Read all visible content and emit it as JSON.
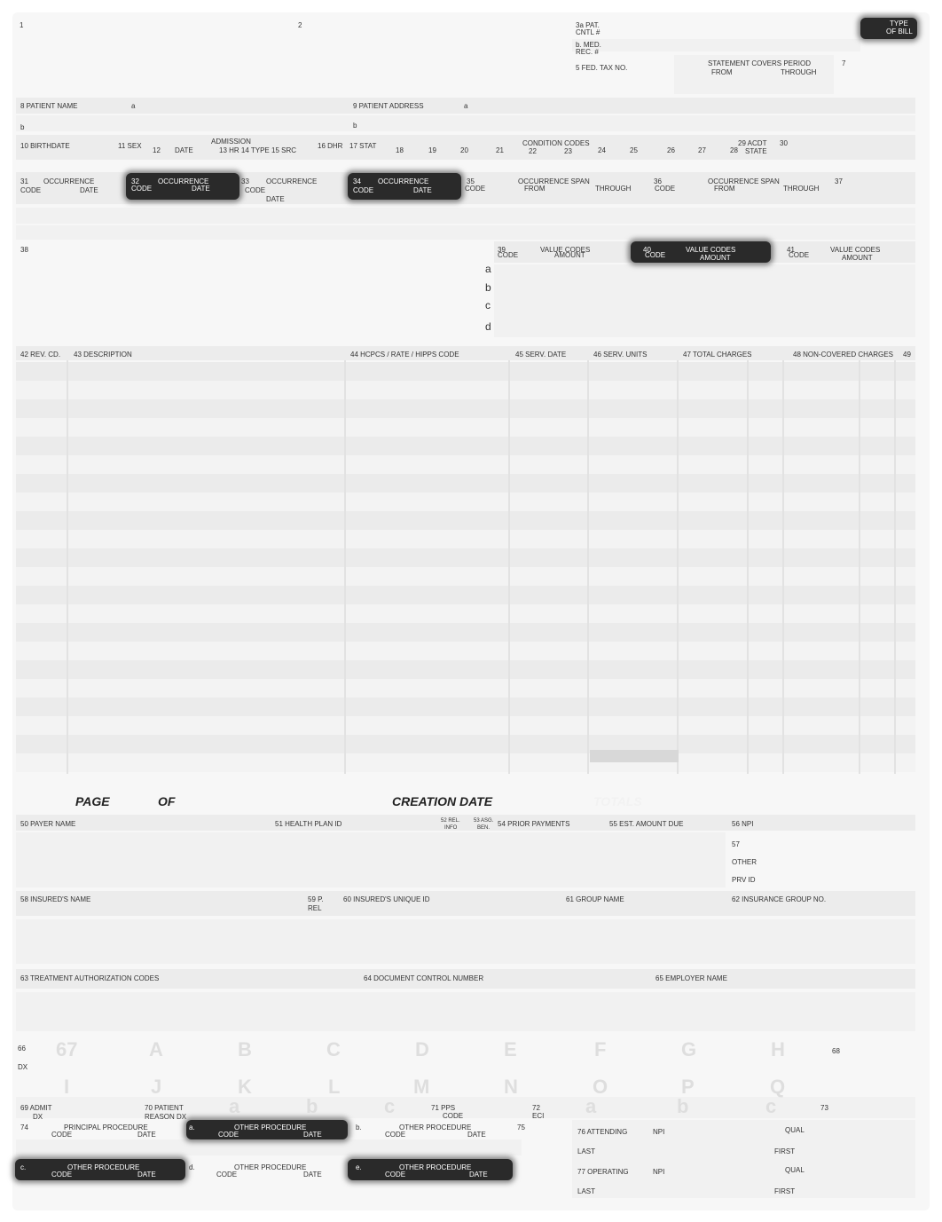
{
  "header": {
    "f1": "1",
    "f2": "2",
    "f3a": "3a PAT.",
    "f3a_b": "CNTL #",
    "f3b": "b. MED.",
    "f3b_b": "REC. #",
    "type_of_bill": "TYPE",
    "type_of_bill_b": "OF BILL",
    "f5": "5 FED. TAX NO.",
    "f6": "STATEMENT COVERS PERIOD",
    "f6_from": "FROM",
    "f6_through": "THROUGH",
    "f7": "7"
  },
  "patient": {
    "f8": "8 PATIENT NAME",
    "f8a": "a",
    "f8b": "b",
    "f9": "9 PATIENT ADDRESS",
    "f9a": "a",
    "f9b": "b"
  },
  "admission": {
    "f10": "10 BIRTHDATE",
    "f11": "11 SEX",
    "f12": "12",
    "date": "DATE",
    "admission": "ADMISSION",
    "f13_15": "13 HR 14 TYPE 15 SRC",
    "f16": "16 DHR",
    "f17": "17 STAT",
    "condition_codes": "CONDITION CODES",
    "codes": [
      "18",
      "19",
      "20",
      "21",
      "22",
      "23",
      "24",
      "25",
      "26",
      "27",
      "28"
    ],
    "f29": "29 ACDT",
    "f29_b": "STATE",
    "f30": "30"
  },
  "occurrence": {
    "f31": "31",
    "occ": "OCCURRENCE",
    "code": "CODE",
    "date": "DATE",
    "f32": "32",
    "f33": "33",
    "f34": "34",
    "f35": "35",
    "span": "OCCURRENCE SPAN",
    "from": "FROM",
    "through": "THROUGH",
    "f36": "36",
    "f37": "37"
  },
  "value_codes": {
    "f38": "38",
    "f39": "39",
    "f40": "40",
    "f41": "41",
    "title": "VALUE CODES",
    "code": "CODE",
    "amount": "AMOUNT",
    "letters": [
      "a",
      "b",
      "c",
      "d"
    ]
  },
  "lines": {
    "headers": [
      "42 REV. CD.",
      "43 DESCRIPTION",
      "44 HCPCS / RATE / HIPPS CODE",
      "45 SERV. DATE",
      "46 SERV. UNITS",
      "47 TOTAL CHARGES",
      "48 NON-COVERED CHARGES",
      "49"
    ]
  },
  "footer_row": {
    "page": "PAGE",
    "of": "OF",
    "creation_date": "CREATION DATE",
    "totals": "TOTALS"
  },
  "payer": {
    "f50": "50 PAYER NAME",
    "f51": "51 HEALTH PLAN ID",
    "f52": "52 REL.",
    "f52_b": "INFO",
    "f53": "53 ASG.",
    "f53_b": "BEN.",
    "f54": "54 PRIOR PAYMENTS",
    "f55": "55 EST. AMOUNT DUE",
    "f56": "56 NPI",
    "f57": "57",
    "other": "OTHER",
    "prv_id": "PRV ID"
  },
  "insured": {
    "f58": "58 INSURED'S NAME",
    "f59": "59 P.",
    "f59_b": "REL",
    "f60": "60 INSURED'S UNIQUE ID",
    "f61": "61 GROUP NAME",
    "f62": "62 INSURANCE GROUP NO."
  },
  "auth": {
    "f63": "63 TREATMENT AUTHORIZATION CODES",
    "f64": "64 DOCUMENT CONTROL NUMBER",
    "f65": "65 EMPLOYER NAME"
  },
  "diagnosis": {
    "f66": "66",
    "dx": "DX",
    "row1": [
      "67",
      "A",
      "B",
      "C",
      "D",
      "E",
      "F",
      "G",
      "H"
    ],
    "row2": [
      "I",
      "J",
      "K",
      "L",
      "M",
      "N",
      "O",
      "P",
      "Q"
    ],
    "f68": "68",
    "f69": "69 ADMIT",
    "f69_b": "DX",
    "f70": "70 PATIENT",
    "f70_b": "REASON DX",
    "reason_letters": [
      "a",
      "b",
      "c"
    ],
    "f71": "71 PPS",
    "f71_b": "CODE",
    "f72": "72",
    "f72_b": "ECI",
    "eci_letters": [
      "a",
      "b",
      "c"
    ],
    "f73": "73"
  },
  "procedures": {
    "f74": "74",
    "principal": "PRINCIPAL PROCEDURE",
    "other": "OTHER PROCEDURE",
    "code": "CODE",
    "date": "DATE",
    "a": "a.",
    "b": "b.",
    "c": "c.",
    "d": "d.",
    "e": "e.",
    "f75": "75"
  },
  "physicians": {
    "f76": "76 ATTENDING",
    "f77": "77 OPERATING",
    "npi": "NPI",
    "qual": "QUAL",
    "last": "LAST",
    "first": "FIRST"
  }
}
